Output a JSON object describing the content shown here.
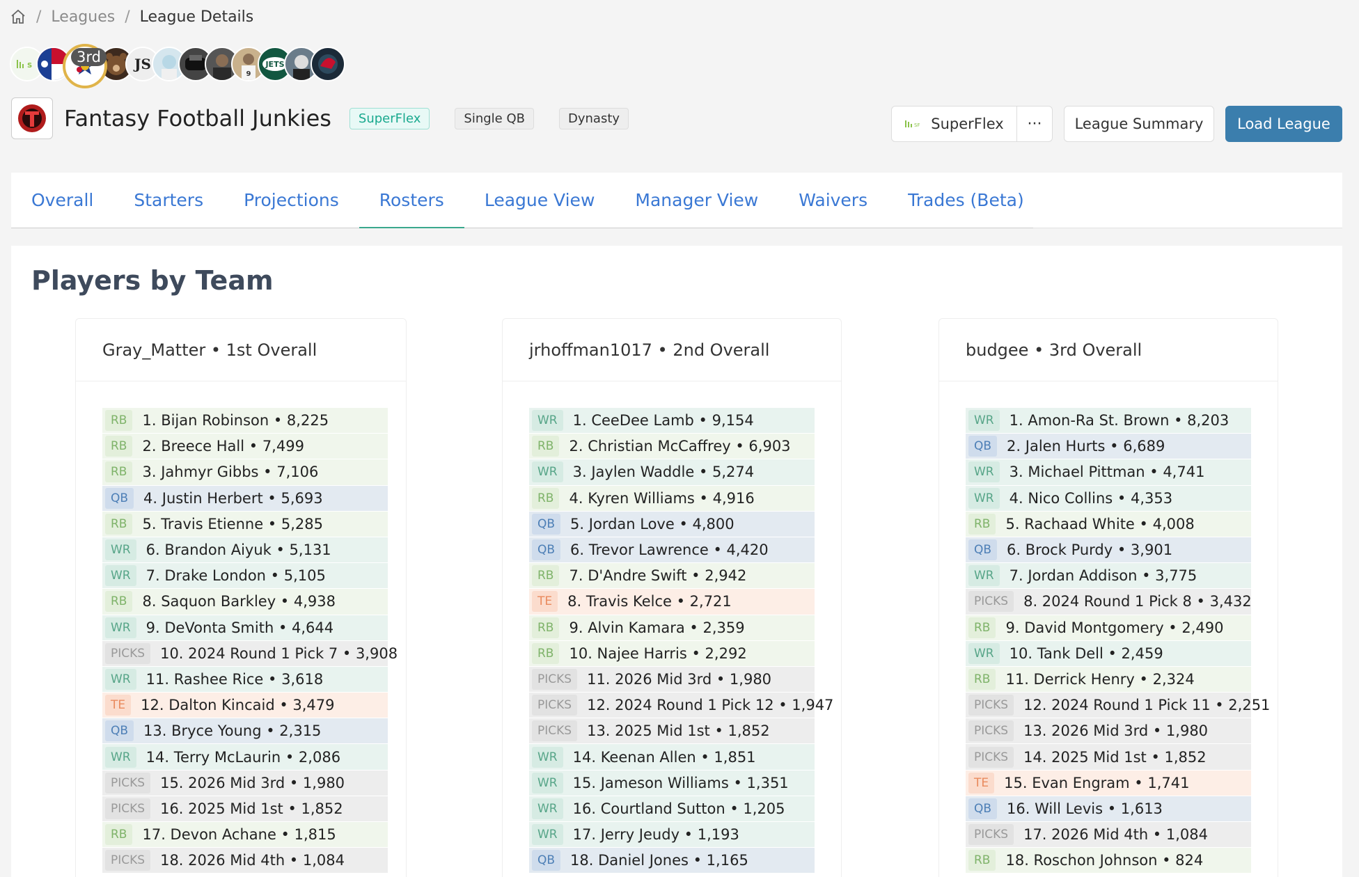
{
  "breadcrumb": {
    "leagues": "Leagues",
    "current": "League Details",
    "sep": "/"
  },
  "rank_badge": "3rd",
  "league": {
    "name": "Fantasy Football Junkies",
    "tags": [
      "SuperFlex",
      "Single QB",
      "Dynasty"
    ]
  },
  "header_buttons": {
    "format": "SuperFlex",
    "more": "···",
    "summary": "League Summary",
    "load": "Load League"
  },
  "tabs": [
    "Overall",
    "Starters",
    "Projections",
    "Rosters",
    "League View",
    "Manager View",
    "Waivers",
    "Trades (Beta)"
  ],
  "active_tab": "Rosters",
  "section_title": "Players by Team",
  "teams": [
    {
      "title": "Gray_Matter • 1st Overall",
      "players": [
        {
          "pos": "RB",
          "text": "1. Bijan Robinson • 8,225"
        },
        {
          "pos": "RB",
          "text": "2. Breece Hall • 7,499"
        },
        {
          "pos": "RB",
          "text": "3. Jahmyr Gibbs • 7,106"
        },
        {
          "pos": "QB",
          "text": "4. Justin Herbert • 5,693"
        },
        {
          "pos": "RB",
          "text": "5. Travis Etienne • 5,285"
        },
        {
          "pos": "WR",
          "text": "6. Brandon Aiyuk • 5,131"
        },
        {
          "pos": "WR",
          "text": "7. Drake London • 5,105"
        },
        {
          "pos": "RB",
          "text": "8. Saquon Barkley • 4,938"
        },
        {
          "pos": "WR",
          "text": "9. DeVonta Smith • 4,644"
        },
        {
          "pos": "PICKS",
          "text": "10. 2024 Round 1 Pick 7 • 3,908"
        },
        {
          "pos": "WR",
          "text": "11. Rashee Rice • 3,618"
        },
        {
          "pos": "TE",
          "text": "12. Dalton Kincaid • 3,479"
        },
        {
          "pos": "QB",
          "text": "13. Bryce Young • 2,315"
        },
        {
          "pos": "WR",
          "text": "14. Terry McLaurin • 2,086"
        },
        {
          "pos": "PICKS",
          "text": "15. 2026 Mid 3rd • 1,980"
        },
        {
          "pos": "PICKS",
          "text": "16. 2025 Mid 1st • 1,852"
        },
        {
          "pos": "RB",
          "text": "17. Devon Achane • 1,815"
        },
        {
          "pos": "PICKS",
          "text": "18. 2026 Mid 4th • 1,084"
        }
      ]
    },
    {
      "title": "jrhoffman1017 • 2nd Overall",
      "players": [
        {
          "pos": "WR",
          "text": "1. CeeDee Lamb • 9,154"
        },
        {
          "pos": "RB",
          "text": "2. Christian McCaffrey • 6,903"
        },
        {
          "pos": "WR",
          "text": "3. Jaylen Waddle • 5,274"
        },
        {
          "pos": "RB",
          "text": "4. Kyren Williams • 4,916"
        },
        {
          "pos": "QB",
          "text": "5. Jordan Love • 4,800"
        },
        {
          "pos": "QB",
          "text": "6. Trevor Lawrence • 4,420"
        },
        {
          "pos": "RB",
          "text": "7. D'Andre Swift • 2,942"
        },
        {
          "pos": "TE",
          "text": "8. Travis Kelce • 2,721"
        },
        {
          "pos": "RB",
          "text": "9. Alvin Kamara • 2,359"
        },
        {
          "pos": "RB",
          "text": "10. Najee Harris • 2,292"
        },
        {
          "pos": "PICKS",
          "text": "11. 2026 Mid 3rd • 1,980"
        },
        {
          "pos": "PICKS",
          "text": "12. 2024 Round 1 Pick 12 • 1,947"
        },
        {
          "pos": "PICKS",
          "text": "13. 2025 Mid 1st • 1,852"
        },
        {
          "pos": "WR",
          "text": "14. Keenan Allen • 1,851"
        },
        {
          "pos": "WR",
          "text": "15. Jameson Williams • 1,351"
        },
        {
          "pos": "WR",
          "text": "16. Courtland Sutton • 1,205"
        },
        {
          "pos": "WR",
          "text": "17. Jerry Jeudy • 1,193"
        },
        {
          "pos": "QB",
          "text": "18. Daniel Jones • 1,165"
        }
      ]
    },
    {
      "title": "budgee • 3rd Overall",
      "players": [
        {
          "pos": "WR",
          "text": "1. Amon-Ra St. Brown • 8,203"
        },
        {
          "pos": "QB",
          "text": "2. Jalen Hurts • 6,689"
        },
        {
          "pos": "WR",
          "text": "3. Michael Pittman • 4,741"
        },
        {
          "pos": "WR",
          "text": "4. Nico Collins • 4,353"
        },
        {
          "pos": "RB",
          "text": "5. Rachaad White • 4,008"
        },
        {
          "pos": "QB",
          "text": "6. Brock Purdy • 3,901"
        },
        {
          "pos": "WR",
          "text": "7. Jordan Addison • 3,775"
        },
        {
          "pos": "PICKS",
          "text": "8. 2024 Round 1 Pick 8 • 3,432"
        },
        {
          "pos": "RB",
          "text": "9. David Montgomery • 2,490"
        },
        {
          "pos": "WR",
          "text": "10. Tank Dell • 2,459"
        },
        {
          "pos": "RB",
          "text": "11. Derrick Henry • 2,324"
        },
        {
          "pos": "PICKS",
          "text": "12. 2024 Round 1 Pick 11 • 2,251"
        },
        {
          "pos": "PICKS",
          "text": "13. 2026 Mid 3rd • 1,980"
        },
        {
          "pos": "PICKS",
          "text": "14. 2025 Mid 1st • 1,852"
        },
        {
          "pos": "TE",
          "text": "15. Evan Engram • 1,741"
        },
        {
          "pos": "QB",
          "text": "16. Will Levis • 1,613"
        },
        {
          "pos": "PICKS",
          "text": "17. 2026 Mid 4th • 1,084"
        },
        {
          "pos": "RB",
          "text": "18. Roschon Johnson • 824"
        }
      ]
    }
  ]
}
